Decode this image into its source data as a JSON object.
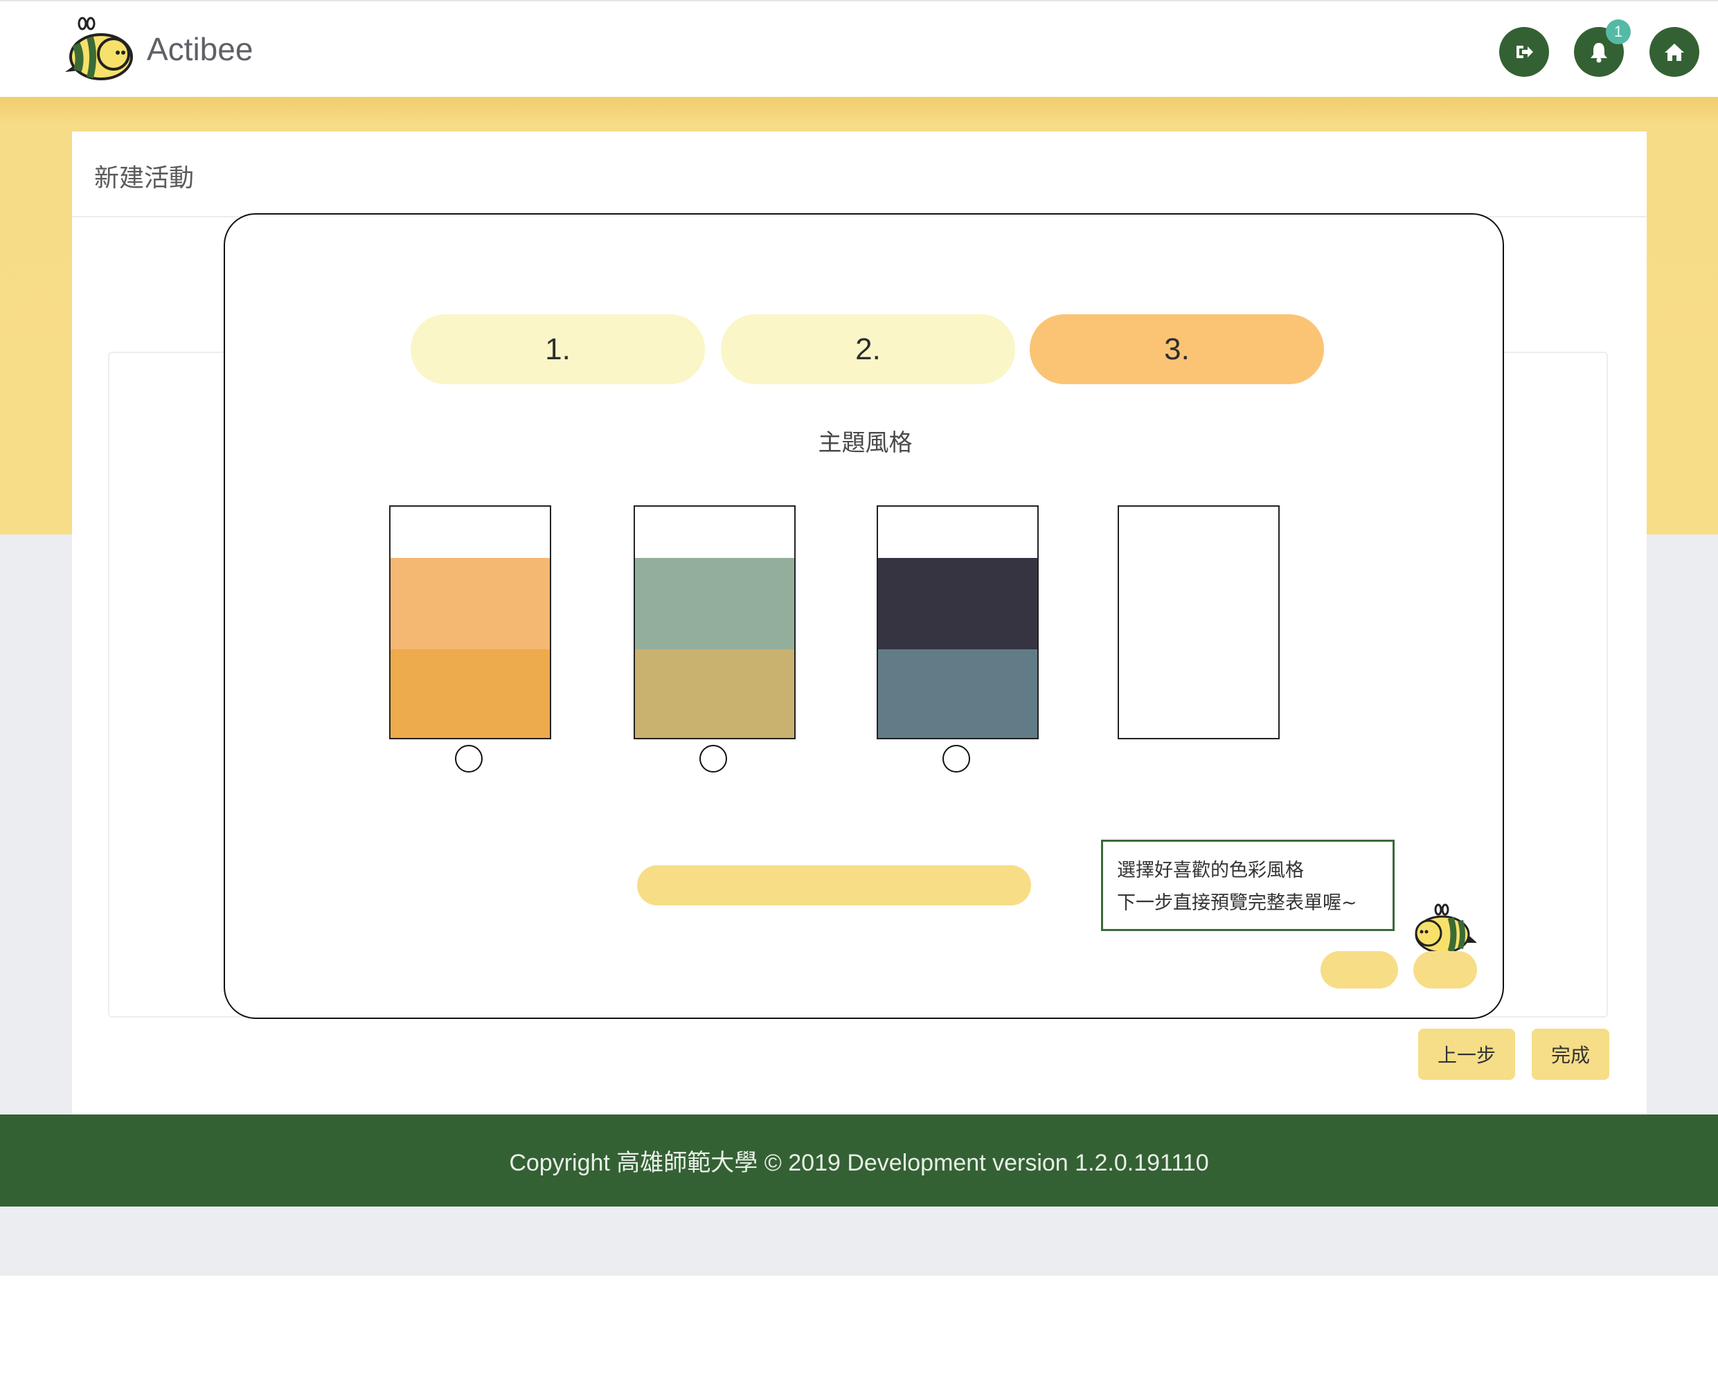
{
  "header": {
    "brand": "Actibee",
    "icons": [
      "logout-icon",
      "bell-icon",
      "home-icon"
    ],
    "notification_count": "1"
  },
  "card": {
    "title": "新建活動"
  },
  "modal": {
    "steps": [
      {
        "label": "1.",
        "active": false
      },
      {
        "label": "2.",
        "active": false
      },
      {
        "label": "3.",
        "active": true
      }
    ],
    "section_title": "主題風格",
    "themes": [
      {
        "top": "#ffffff",
        "middle": "#f5b873",
        "bottom": "#edab4d",
        "selected": false
      },
      {
        "top": "#ffffff",
        "middle": "#93af9c",
        "bottom": "#c9b16f",
        "selected": false
      },
      {
        "top": "#ffffff",
        "middle": "#363441",
        "bottom": "#627c87",
        "selected": false
      },
      {
        "top": "#ffffff",
        "middle": "#ffffff",
        "bottom": "#ffffff",
        "selected": false
      }
    ],
    "tip": {
      "line1": "選擇好喜歡的色彩風格",
      "line2": "下一步直接預覽完整表單喔~"
    }
  },
  "footer_buttons": {
    "prev": "上一步",
    "finish": "完成"
  },
  "footer": {
    "text": "Copyright 高雄師範大學 © 2019 Development version 1.2.0.191110"
  },
  "colors": {
    "brand_green": "#346133",
    "yellow": "#f8dd88",
    "active_step": "#fbc475",
    "inactive_step": "#faf6c7"
  }
}
